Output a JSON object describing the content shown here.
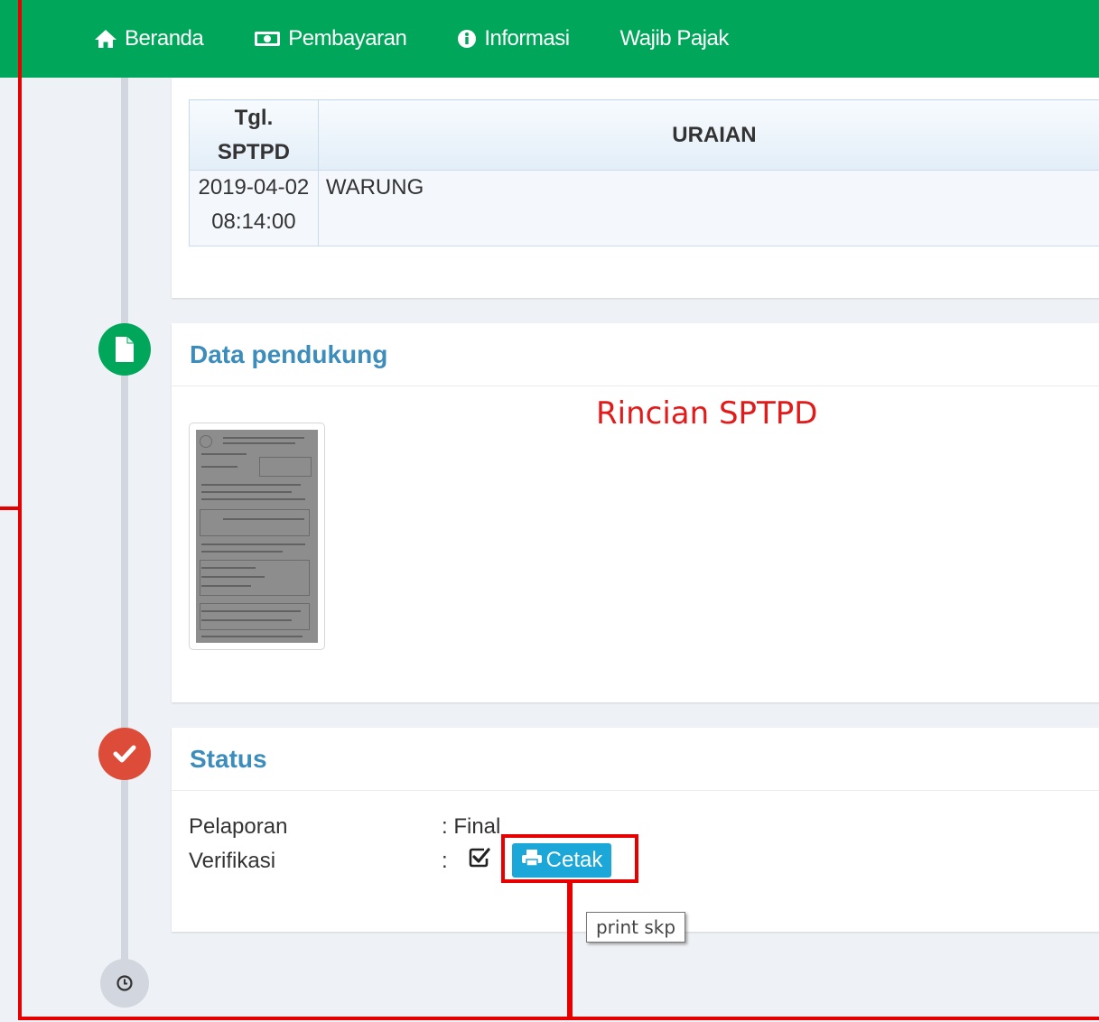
{
  "nav": {
    "items": [
      {
        "label": "Beranda",
        "icon": "home-icon"
      },
      {
        "label": "Pembayaran",
        "icon": "money-icon"
      },
      {
        "label": "Informasi",
        "icon": "info-icon"
      },
      {
        "label": "Wajib Pajak",
        "icon": ""
      }
    ]
  },
  "table": {
    "headers": {
      "date": "Tgl.\nSPTPD",
      "uraian": "URAIAN"
    },
    "rows": [
      {
        "date": "2019-04-02 08:14:00",
        "uraian": "WARUNG"
      }
    ]
  },
  "data_pendukung": {
    "title": "Data pendukung",
    "thumbnail": "document-scan"
  },
  "annotation": {
    "caption": "Rincian SPTPD"
  },
  "status": {
    "title": "Status",
    "pelaporan_label": "Pelaporan",
    "pelaporan_value": ": Final",
    "verifikasi_label": "Verifikasi",
    "verifikasi_sep": ":",
    "cetak_label": "Cetak",
    "tooltip": "print skp"
  },
  "colors": {
    "nav_bg": "#00a65a",
    "title_blue": "#3c8dbc",
    "button_blue": "#1ba7d8",
    "annotation_red": "#e60000"
  }
}
